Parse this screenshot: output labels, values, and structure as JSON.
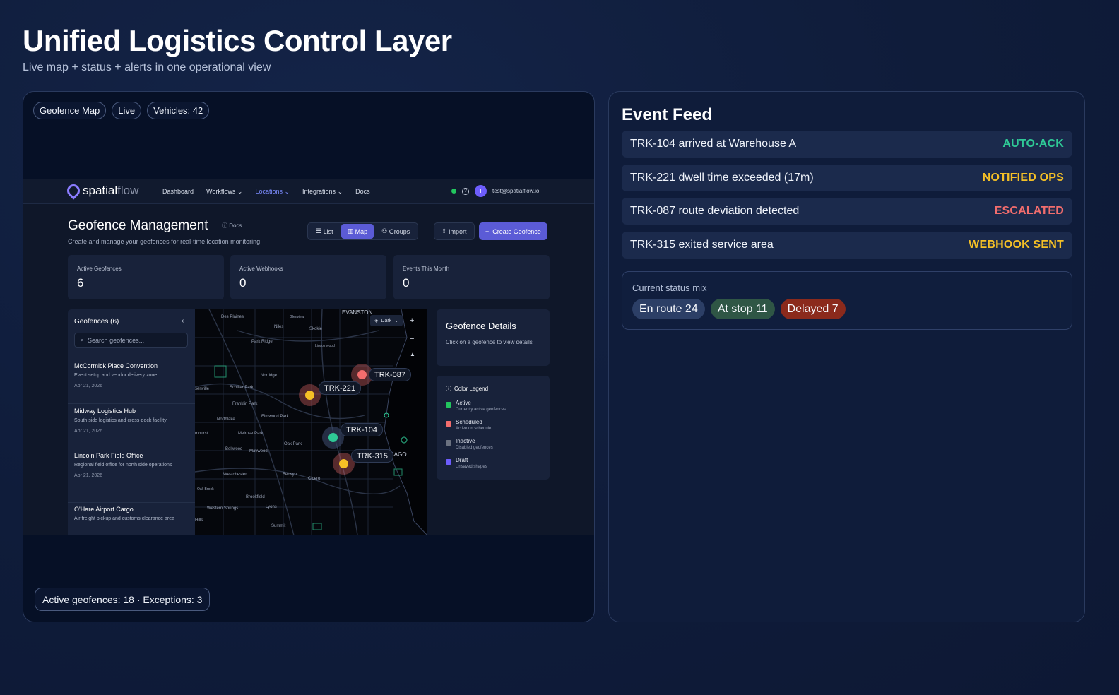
{
  "header": {
    "title": "Unified Logistics Control Layer",
    "subtitle": "Live map + status + alerts in one operational view"
  },
  "map_panel": {
    "chips": [
      "Geofence Map",
      "Live",
      "Vehicles: 42"
    ],
    "footer": "Active geofences: 18 · Exceptions: 3"
  },
  "app": {
    "logo": {
      "bold": "spatial",
      "light": "flow"
    },
    "nav": [
      "Dashboard",
      "Workflows",
      "Locations",
      "Integrations",
      "Docs"
    ],
    "nav_chevrons": {
      "workflows": "⌄",
      "locations": "⌄",
      "integrations": "⌄"
    },
    "user_initial": "T",
    "user_email": "test@spatialflow.io",
    "title": "Geofence Management",
    "docs_link": "Docs",
    "subtitle": "Create and manage your geofences for real-time location monitoring",
    "view_buttons": [
      "List",
      "Map",
      "Groups"
    ],
    "import_label": "Import",
    "create_label": "Create Geofence",
    "stats": [
      {
        "label": "Active Geofences",
        "value": "6"
      },
      {
        "label": "Active Webhooks",
        "value": "0"
      },
      {
        "label": "Events This Month",
        "value": "0"
      }
    ],
    "list": {
      "heading": "Geofences (6)",
      "search_placeholder": "Search geofences...",
      "items": [
        {
          "name": "McCormick Place Convention",
          "desc": "Event setup and vendor delivery zone",
          "date": "Apr 21, 2026"
        },
        {
          "name": "Midway Logistics Hub",
          "desc": "South side logistics and cross-dock facility",
          "date": "Apr 21, 2026"
        },
        {
          "name": "Lincoln Park Field Office",
          "desc": "Regional field office for north side operations",
          "date": "Apr 21, 2026"
        },
        {
          "name": "O'Hare Airport Cargo",
          "desc": "Air freight pickup and customs clearance area",
          "date": ""
        }
      ]
    },
    "map": {
      "style_toggle": "Dark",
      "place_labels": [
        "EVANSTON",
        "Des Plaines",
        "Niles",
        "Glenview",
        "Skokie",
        "Park Ridge",
        "Lincolnwood",
        "Norridge",
        "Schiller Park",
        "Franklin Park",
        "Northlake",
        "Elmwood Park",
        "Melrose Park",
        "Bellwood",
        "Maywood",
        "Oak Park",
        "Westchester",
        "Berwyn",
        "Cicero",
        "Oak Brook",
        "Brookfield",
        "Western Springs",
        "Lyons",
        "Summit",
        "CAGO",
        "senville",
        "mhurst",
        "Hills"
      ],
      "trucks": [
        {
          "id": "TRK-087",
          "color": "#f26d6d"
        },
        {
          "id": "TRK-221",
          "color": "#f5c026"
        },
        {
          "id": "TRK-104",
          "color": "#2fc996"
        },
        {
          "id": "TRK-315",
          "color": "#f5c026"
        }
      ]
    },
    "details": {
      "title": "Geofence Details",
      "body": "Click on a geofence to view details"
    },
    "legend": {
      "title": "Color Legend",
      "items": [
        {
          "name": "Active",
          "sub": "Currently active geofences",
          "color": "#22c55e"
        },
        {
          "name": "Scheduled",
          "sub": "Active on schedule",
          "color": "#f26d6d"
        },
        {
          "name": "Inactive",
          "sub": "Disabled geofences",
          "color": "#6b7280"
        },
        {
          "name": "Draft",
          "sub": "Unsaved shapes",
          "color": "#6d5dfc"
        }
      ]
    }
  },
  "feed": {
    "title": "Event Feed",
    "events": [
      {
        "text": "TRK-104 arrived at Warehouse A",
        "status": "AUTO-ACK",
        "color": "#2fc996"
      },
      {
        "text": "TRK-221 dwell time exceeded (17m)",
        "status": "NOTIFIED OPS",
        "color": "#f5c026"
      },
      {
        "text": "TRK-087 route deviation detected",
        "status": "ESCALATED",
        "color": "#f26d6d"
      },
      {
        "text": "TRK-315 exited service area",
        "status": "WEBHOOK SENT",
        "color": "#f5c026"
      }
    ],
    "mix": {
      "label": "Current status mix",
      "pills": [
        {
          "text": "En route 24",
          "bg": "#2c3f66"
        },
        {
          "text": "At stop 11",
          "bg": "#2f5645"
        },
        {
          "text": "Delayed 7",
          "bg": "#8b2a1c"
        }
      ]
    }
  }
}
